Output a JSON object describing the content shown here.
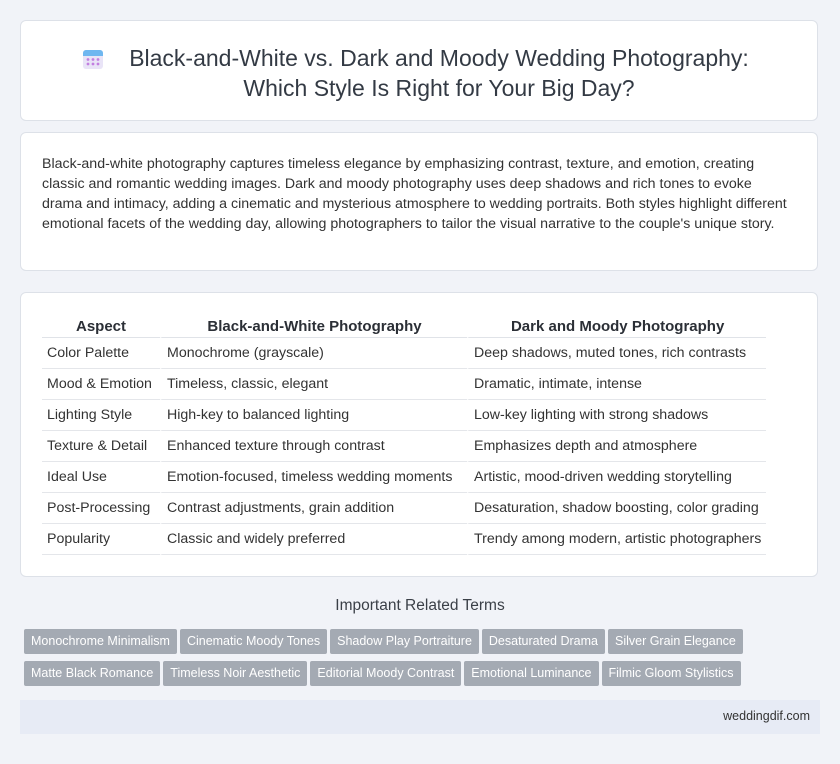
{
  "header": {
    "icon": "calendar-icon",
    "title": "Black-and-White vs. Dark and Moody Wedding Photography: Which Style Is Right for Your Big Day?"
  },
  "intro": "Black-and-white photography captures timeless elegance by emphasizing contrast, texture, and emotion, creating classic and romantic wedding images. Dark and moody photography uses deep shadows and rich tones to evoke drama and intimacy, adding a cinematic and mysterious atmosphere to wedding portraits. Both styles highlight different emotional facets of the wedding day, allowing photographers to tailor the visual narrative to the couple's unique story.",
  "table": {
    "headers": [
      "Aspect",
      "Black-and-White Photography",
      "Dark and Moody Photography"
    ],
    "rows": [
      [
        "Color Palette",
        "Monochrome (grayscale)",
        "Deep shadows, muted tones, rich contrasts"
      ],
      [
        "Mood & Emotion",
        "Timeless, classic, elegant",
        "Dramatic, intimate, intense"
      ],
      [
        "Lighting Style",
        "High-key to balanced lighting",
        "Low-key lighting with strong shadows"
      ],
      [
        "Texture & Detail",
        "Enhanced texture through contrast",
        "Emphasizes depth and atmosphere"
      ],
      [
        "Ideal Use",
        "Emotion-focused, timeless wedding moments",
        "Artistic, mood-driven wedding storytelling"
      ],
      [
        "Post-Processing",
        "Contrast adjustments, grain addition",
        "Desaturation, shadow boosting, color grading"
      ],
      [
        "Popularity",
        "Classic and widely preferred",
        "Trendy among modern, artistic photographers"
      ]
    ]
  },
  "related": {
    "title": "Important Related Terms",
    "tags": [
      "Monochrome Minimalism",
      "Cinematic Moody Tones",
      "Shadow Play Portraiture",
      "Desaturated Drama",
      "Silver Grain Elegance",
      "Matte Black Romance",
      "Timeless Noir Aesthetic",
      "Editorial Moody Contrast",
      "Emotional Luminance",
      "Filmic Gloom Stylistics"
    ]
  },
  "footer": {
    "site": "weddingdif.com"
  },
  "colors": {
    "background": "#f1f3f8",
    "tag": "#a4aab3",
    "footer": "#e7ebf5"
  }
}
